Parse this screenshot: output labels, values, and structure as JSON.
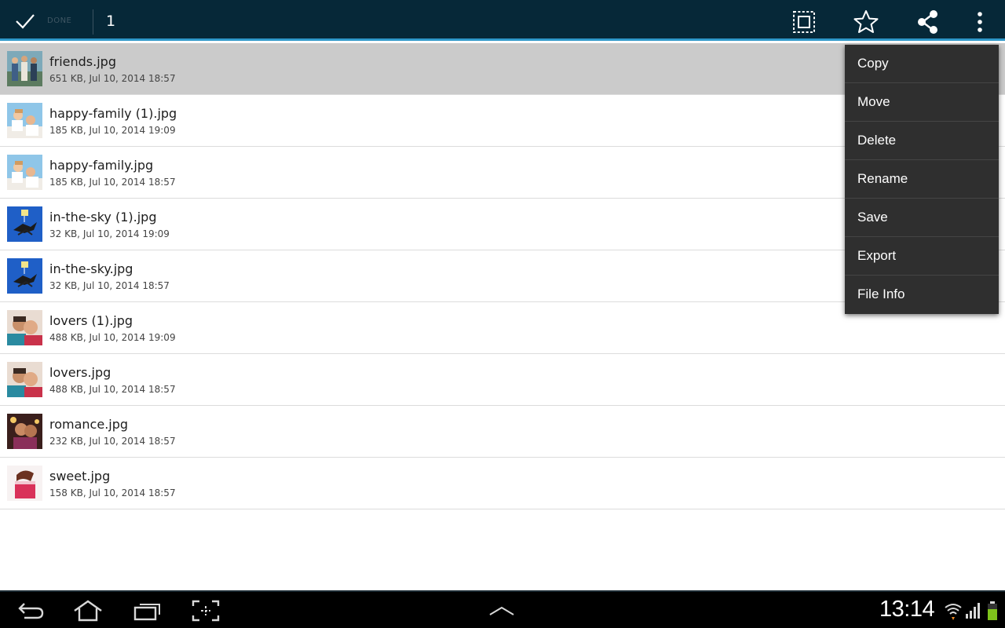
{
  "action_bar": {
    "done_label": "DONE",
    "selected_count": "1",
    "icons": [
      "select-all-icon",
      "star-icon",
      "share-icon",
      "overflow-menu-icon"
    ],
    "background_color": "#062838",
    "accent_color": "#2f98c9"
  },
  "files": [
    {
      "name": "friends.jpg",
      "meta": "651 KB, Jul 10, 2014 18:57",
      "selected": true,
      "thumb": "friends-thumbnail"
    },
    {
      "name": "happy-family (1).jpg",
      "meta": "185 KB, Jul 10, 2014 19:09",
      "selected": false,
      "thumb": "happy-family-thumbnail"
    },
    {
      "name": "happy-family.jpg",
      "meta": "185 KB, Jul 10, 2014 18:57",
      "selected": false,
      "thumb": "happy-family-thumbnail"
    },
    {
      "name": "in-the-sky (1).jpg",
      "meta": "32 KB, Jul 10, 2014 19:09",
      "selected": false,
      "thumb": "in-the-sky-thumbnail"
    },
    {
      "name": "in-the-sky.jpg",
      "meta": "32 KB, Jul 10, 2014 18:57",
      "selected": false,
      "thumb": "in-the-sky-thumbnail"
    },
    {
      "name": "lovers (1).jpg",
      "meta": "488 KB, Jul 10, 2014 19:09",
      "selected": false,
      "thumb": "lovers-thumbnail"
    },
    {
      "name": "lovers.jpg",
      "meta": "488 KB, Jul 10, 2014 18:57",
      "selected": false,
      "thumb": "lovers-thumbnail"
    },
    {
      "name": "romance.jpg",
      "meta": "232 KB, Jul 10, 2014 18:57",
      "selected": false,
      "thumb": "romance-thumbnail"
    },
    {
      "name": "sweet.jpg",
      "meta": "158 KB, Jul 10, 2014 18:57",
      "selected": false,
      "thumb": "sweet-thumbnail"
    }
  ],
  "menu": {
    "items": [
      "Copy",
      "Move",
      "Delete",
      "Rename",
      "Save",
      "Export",
      "File Info"
    ]
  },
  "system_bar": {
    "nav_icons": [
      "back-icon",
      "home-icon",
      "recent-apps-icon",
      "screenshot-icon",
      "chevron-up-icon"
    ],
    "clock": "13:14",
    "status_icons": [
      "wifi-icon",
      "signal-icon",
      "battery-icon"
    ],
    "battery_color": "#7ec31b"
  }
}
